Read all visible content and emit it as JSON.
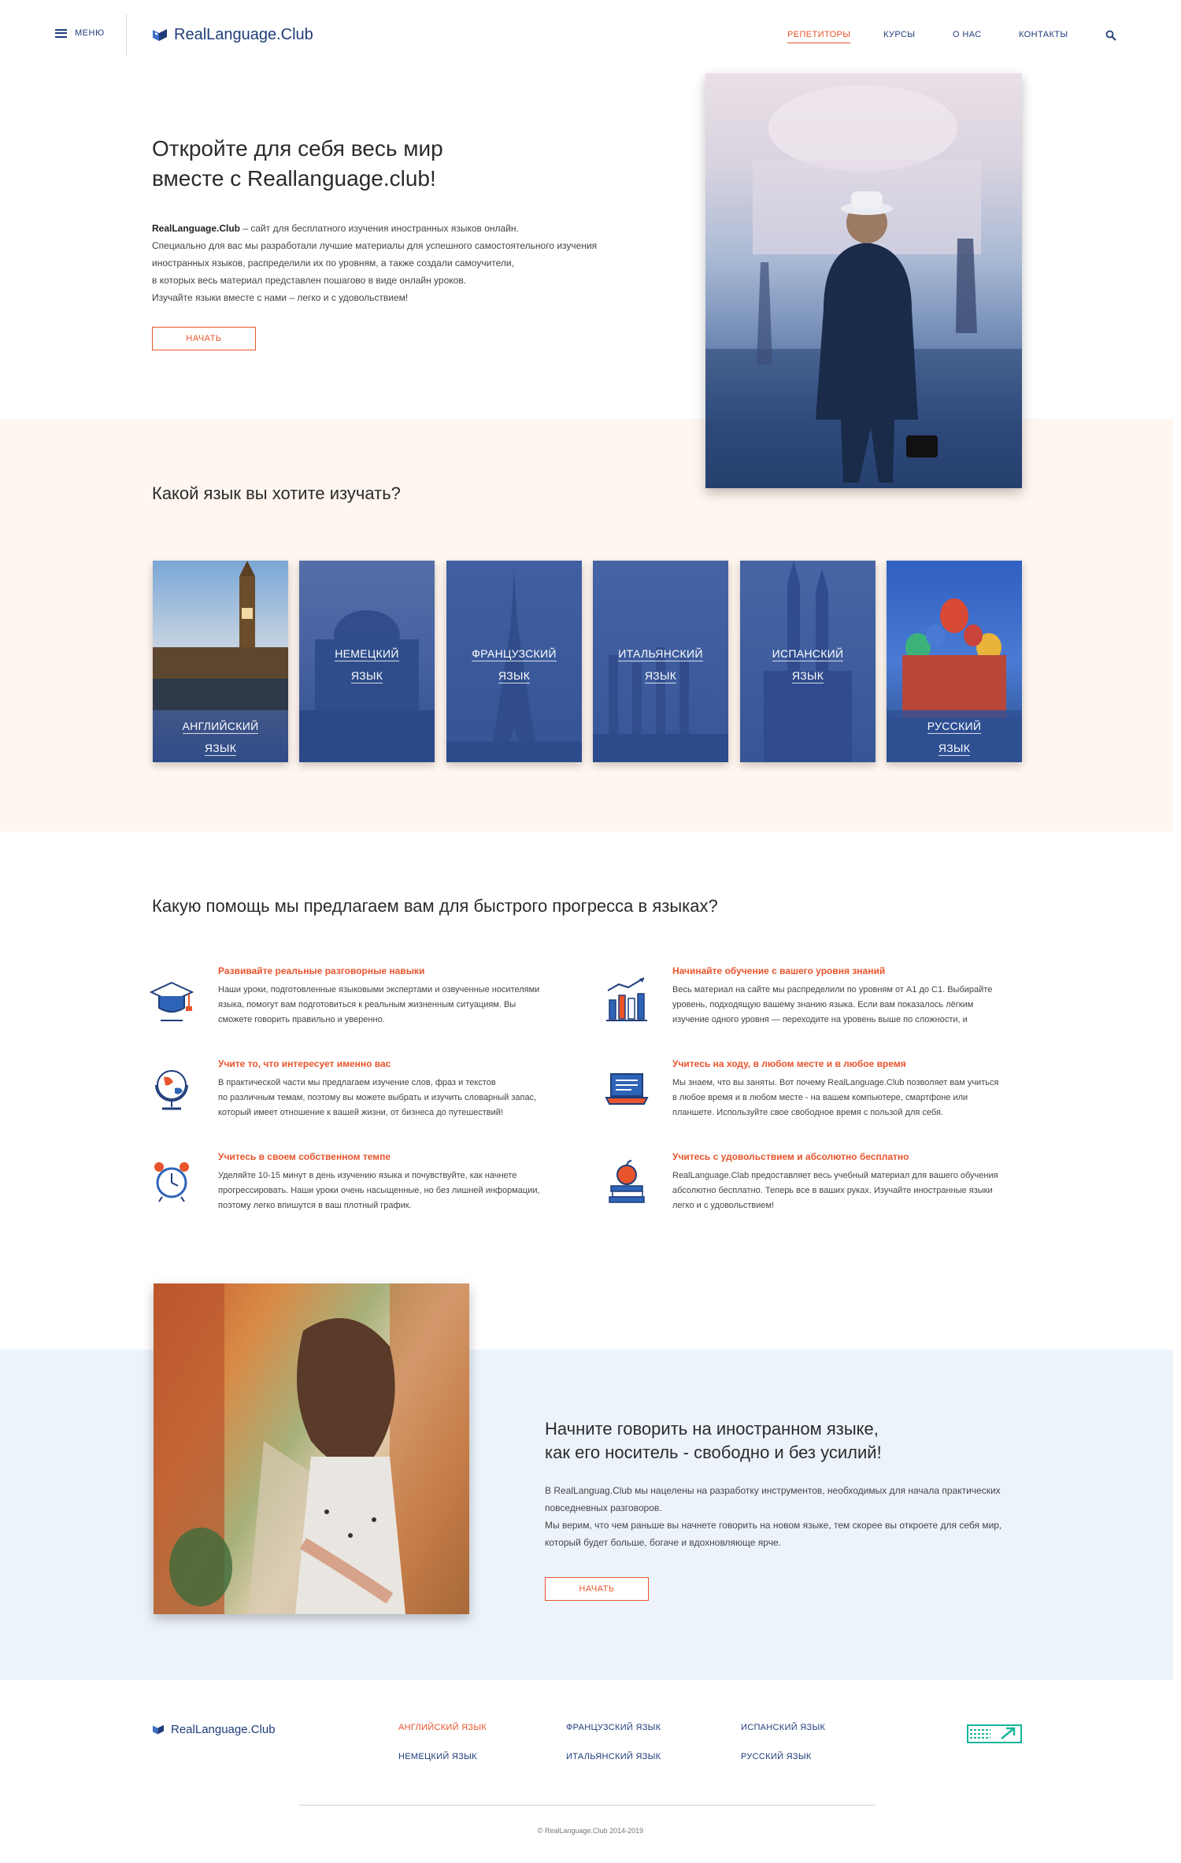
{
  "header": {
    "menu_label": "МЕНЮ",
    "logo_text": "RealLanguage.Club",
    "nav": [
      {
        "label": "РЕПЕТИТОРЫ",
        "active": true
      },
      {
        "label": "КУРСЫ",
        "active": false
      },
      {
        "label": "О НАС",
        "active": false
      },
      {
        "label": "КОНТАКТЫ",
        "active": false
      }
    ],
    "search_icon": "search-icon"
  },
  "hero": {
    "title_line1": "Откройте для себя  весь мир",
    "title_line2": "вместе с Reallanguage.club!",
    "brand": "RealLanguage.Club",
    "lead_rest": " – сайт для бесплатного изучения иностранных языков онлайн.",
    "lines": [
      "Специально для вас мы разработали лучшие материалы для успешного самостоятельного изучения",
      "иностранных языков, распределили их по уровням, а также создали самоучители,",
      "в которых весь материал представлен пошагово в виде онлайн уроков.",
      "Изучайте языки вместе с нами – легко и с удовольствием!"
    ],
    "button": "НАЧАТЬ"
  },
  "languages": {
    "title": "Какой язык вы хотите изучать?",
    "items": [
      {
        "line1": "АНГЛИЙСКИЙ",
        "line2": "ЯЗЫК"
      },
      {
        "line1": "НЕМЕЦКИЙ",
        "line2": "ЯЗЫК"
      },
      {
        "line1": "ФРАНЦУЗСКИЙ",
        "line2": "ЯЗЫК"
      },
      {
        "line1": "ИТАЛЬЯНСКИЙ",
        "line2": "ЯЗЫК"
      },
      {
        "line1": "ИСПАНСКИЙ",
        "line2": "ЯЗЫК"
      },
      {
        "line1": "РУССКИЙ",
        "line2": "ЯЗЫК"
      }
    ]
  },
  "help": {
    "title": "Какую помощь мы предлагаем вам для быстрого прогресса в языках?",
    "items": [
      {
        "icon": "graduation-cap-icon",
        "title": "Развивайте реальные разговорные навыки",
        "lines": [
          "Наши уроки, подготовленные языковыми экспертами и озвученные носителями",
          "языка, помогут вам подготовиться к реальным жизненным ситуациям. Вы",
          "сможете говорить правильно и уверенно."
        ]
      },
      {
        "icon": "books-chart-icon",
        "title": "Начинайте обучение с вашего уровня знаний",
        "lines": [
          "Весь материал на сайте мы распределили по уровням от А1 до С1. Выбирайте",
          "уровень, подходящую вашему знанию языка. Если вам показалось лёгким",
          "изучение одного уровня — переходите на уровень выше по сложности, и"
        ]
      },
      {
        "icon": "globe-icon",
        "title": "Учите то, что интересует именно вас",
        "lines": [
          "В практической части мы предлагаем изучение слов, фраз и текстов",
          "по различным темам, поэтому вы можете выбрать и изучить словарный запас,",
          "который имеет отношение к вашей жизни, от бизнеса до путешествий!"
        ]
      },
      {
        "icon": "laptop-icon",
        "title": "Учитесь на ходу, в любом месте и в любое время",
        "lines": [
          "Мы знаем, что вы заняты. Вот почему RealLanguage.Club позволяет вам учиться",
          "в любое время и в любом месте - на вашем компьютере, смартфоне или",
          "планшете. Используйте свое свободное время с пользой для себя."
        ]
      },
      {
        "icon": "alarm-clock-icon",
        "title": "Учитесь в своем собственном темпе",
        "lines": [
          "Уделяйте 10-15 минут в день изучению языка и почувствуйте, как начнете",
          "прогрессировать. Наши уроки очень насыщенные, но без лишней информации,",
          "поэтому легко впишутся в ваш плотный график."
        ]
      },
      {
        "icon": "apple-books-icon",
        "title": "Учитесь с удовольствием и абсолютно бесплатно",
        "lines": [
          "RealLanguage.Clab предоставляет весь учебный материал для вашего обучения",
          "абсолютно бесплатно. Теперь все в ваших руках. Изучайте иностранные языки",
          "легко и с удовольствием!"
        ]
      }
    ]
  },
  "talk": {
    "title_line1": "Начните говорить на иностранном языке,",
    "title_line2": "как его носитель - свободно и без усилий!",
    "lines": [
      "В RealLanguag.Club мы нацелены на разработку инструментов, необходимых для начала практических",
      "повседневных разговоров.",
      "Мы верим, что чем раньше вы начнете говорить на новом языке, тем скорее вы откроете для себя мир,",
      "который будет больше, богаче и вдохновляюще ярче."
    ],
    "button": "НАЧАТЬ"
  },
  "footer": {
    "logo_text": "RealLanguage.Club",
    "links": [
      {
        "label": "АНГЛИЙСКИЙ ЯЗЫК",
        "accent": true
      },
      {
        "label": "ФРАНЦУЗСКИЙ ЯЗЫК",
        "accent": false
      },
      {
        "label": "ИСПАНСКИЙ ЯЗЫК",
        "accent": false
      },
      {
        "label": "НЕМЕЦКИЙ ЯЗЫК",
        "accent": false
      },
      {
        "label": "ИТАЛЬЯНСКИЙ ЯЗЫК",
        "accent": false
      },
      {
        "label": "РУССКИЙ ЯЗЫК",
        "accent": false
      }
    ],
    "badge_icon": "studio-badge-icon",
    "copyright": "© RealLanguage.Club 2014-2019"
  },
  "colors": {
    "accent": "#e8542c",
    "brand": "#1f3d7a",
    "peach_band": "#fff6ef",
    "blue_band": "#edf3fb"
  }
}
